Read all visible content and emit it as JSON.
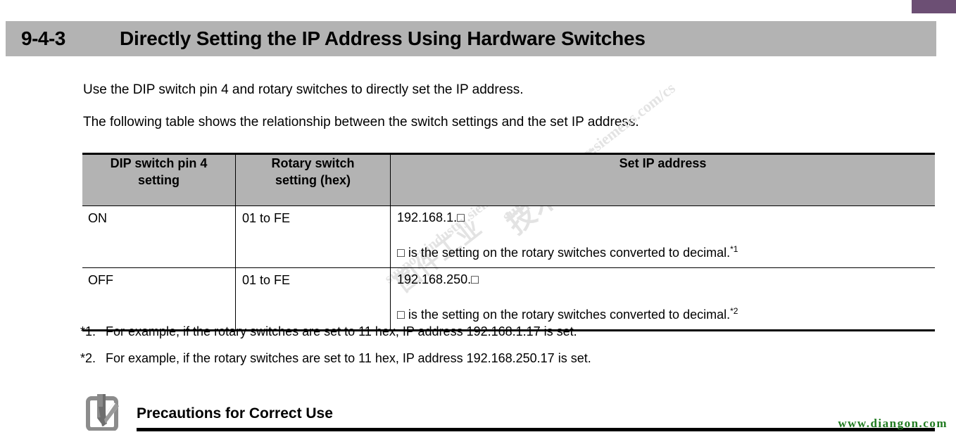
{
  "page": {
    "background_color": "#ffffff",
    "accent_tab_color": "#6c4f74",
    "header_band_color": "#b3b3b3"
  },
  "section": {
    "number": "9-4-3",
    "title": "Directly Setting the IP Address Using Hardware Switches"
  },
  "intro": {
    "paragraph_1": "Use the DIP switch pin 4 and rotary switches to directly set the IP address.",
    "paragraph_2": "The following table shows the relationship between the switch settings and the set IP address."
  },
  "table": {
    "headers": [
      "DIP switch pin 4 setting",
      "Rotary switch setting (hex)",
      "Set IP address"
    ],
    "headers_wrapped": [
      [
        "DIP switch pin 4",
        "setting"
      ],
      [
        "Rotary switch",
        "setting (hex)"
      ],
      [
        "Set IP address"
      ]
    ],
    "rows": [
      {
        "dip_switch": "ON",
        "rotary_switch": "01 to FE",
        "ip_line_1": "192.168.1.□",
        "ip_line_2": "□ is the setting on the rotary switches converted to decimal.",
        "ip_line_2_sup": "*1"
      },
      {
        "dip_switch": "OFF",
        "rotary_switch": "01 to FE",
        "ip_line_1": "192.168.250.□",
        "ip_line_2": "□ is the setting on the rotary switches converted to decimal.",
        "ip_line_2_sup": "*2"
      }
    ]
  },
  "footnotes": [
    {
      "marker": "*1.",
      "text": "For example, if the rotary switches are set to 11 hex, IP address 192.168.1.17 is set."
    },
    {
      "marker": "*2.",
      "text": "For example, if the rotary switches are set to 11 hex, IP address 192.168.250.17 is set."
    }
  ],
  "precautions": {
    "title": "Precautions for Correct Use",
    "icon": "checkmark-clipboard-icon"
  },
  "watermarks": {
    "diagonal_cn": "技术论坛",
    "diagonal_url": "support.industry.siemens.com/cs",
    "diagonal_cn_2": "图件工业",
    "diagonal_url_2": "support.industry.siemens",
    "site": "www.diangon.com",
    "site_color": "#1f7a1f"
  }
}
